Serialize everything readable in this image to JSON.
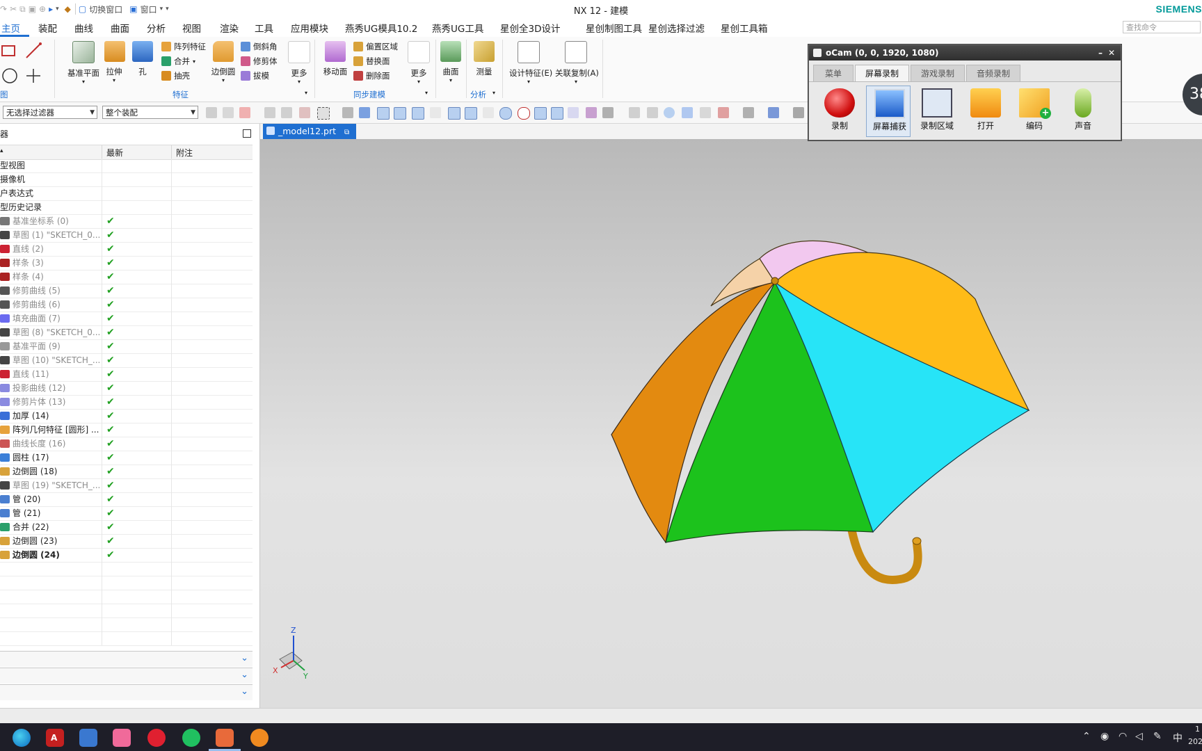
{
  "window": {
    "title": "NX 12 - 建模",
    "brand": "SIEMENS"
  },
  "quick_access": {
    "switch_window": "切换窗口",
    "window": "窗口"
  },
  "menu": {
    "items": [
      "主页",
      "装配",
      "曲线",
      "曲面",
      "分析",
      "视图",
      "渲染",
      "工具",
      "应用模块",
      "燕秀UG模具10.2",
      "燕秀UG工具",
      "星创全3D设计",
      "星创制图工具",
      "星创选择过滤",
      "星创工具箱"
    ],
    "search_placeholder": "查找命令"
  },
  "ribbon": {
    "sketch_group": "图",
    "datum_plane": "基准平面",
    "extrude": "拉伸",
    "hole": "孔",
    "pattern_feature": "阵列特征",
    "unite": "合并",
    "shell": "抽壳",
    "edge_blend": "边倒圆",
    "chamfer": "倒斜角",
    "trim_body": "修剪体",
    "draft": "拔模",
    "more1": "更多",
    "feature_group": "特征",
    "move_face": "移动面",
    "offset_region": "偏置区域",
    "replace_face": "替换面",
    "delete_face": "删除面",
    "more2": "更多",
    "sync_group": "同步建模",
    "surface": "曲面",
    "measure": "测量",
    "analysis_group": "分析",
    "design_feature": "设计特征(E)",
    "associative_copy": "关联复制(A)"
  },
  "filter": {
    "selection_filter": "无选择过滤器",
    "assembly_scope": "整个装配"
  },
  "navigator": {
    "title": "器",
    "col_name": "",
    "col_latest": "最新",
    "col_notes": "附注",
    "top_items": [
      "型视图",
      "摄像机",
      "户表达式",
      "型历史记录"
    ],
    "rows": [
      {
        "name": "基准坐标系 (0)",
        "dim": true,
        "color": "#777"
      },
      {
        "name": "草图 (1) \"SKETCH_0...",
        "dim": true,
        "color": "#444"
      },
      {
        "name": "直线 (2)",
        "dim": true,
        "color": "#c23"
      },
      {
        "name": "样条 (3)",
        "dim": true,
        "color": "#a22"
      },
      {
        "name": "样条 (4)",
        "dim": true,
        "color": "#a22"
      },
      {
        "name": "修剪曲线 (5)",
        "dim": true,
        "color": "#555"
      },
      {
        "name": "修剪曲线 (6)",
        "dim": true,
        "color": "#555"
      },
      {
        "name": "填充曲面 (7)",
        "dim": true,
        "color": "#6a6af0"
      },
      {
        "name": "草图 (8) \"SKETCH_0...",
        "dim": true,
        "color": "#444"
      },
      {
        "name": "基准平面 (9)",
        "dim": true,
        "color": "#999"
      },
      {
        "name": "草图 (10) \"SKETCH_...",
        "dim": true,
        "color": "#444"
      },
      {
        "name": "直线 (11)",
        "dim": true,
        "color": "#c23"
      },
      {
        "name": "投影曲线 (12)",
        "dim": true,
        "color": "#8a8ae0"
      },
      {
        "name": "修剪片体 (13)",
        "dim": true,
        "color": "#8a8ae0"
      },
      {
        "name": "加厚 (14)",
        "dim": false,
        "color": "#3a6fd8"
      },
      {
        "name": "阵列几何特征 [圆形] ...",
        "dim": false,
        "color": "#e6a23c"
      },
      {
        "name": "曲线长度 (16)",
        "dim": true,
        "color": "#c55"
      },
      {
        "name": "圆柱 (17)",
        "dim": false,
        "color": "#3a7fd8"
      },
      {
        "name": "边倒圆 (18)",
        "dim": false,
        "color": "#d8a23a"
      },
      {
        "name": "草图 (19) \"SKETCH_...",
        "dim": true,
        "color": "#444"
      },
      {
        "name": "管 (20)",
        "dim": false,
        "color": "#4a7fd0"
      },
      {
        "name": "管 (21)",
        "dim": false,
        "color": "#4a7fd0"
      },
      {
        "name": "合并 (22)",
        "dim": false,
        "color": "#2aa06a"
      },
      {
        "name": "边倒圆 (23)",
        "dim": false,
        "color": "#d8a23a"
      },
      {
        "name": "边倒圆 (24)",
        "dim": false,
        "bold": true,
        "color": "#d8a23a"
      }
    ],
    "check": "✔"
  },
  "viewport": {
    "file_tab": "_model12.prt",
    "triad": {
      "z": "Z",
      "x": "X",
      "y": "Y"
    }
  },
  "ocam": {
    "title": "oCam (0, 0, 1920, 1080)",
    "tabs": [
      "菜单",
      "屏幕录制",
      "游戏录制",
      "音频录制"
    ],
    "buttons": [
      "录制",
      "屏幕捕获",
      "录制区域",
      "打开",
      "编码",
      "声音"
    ]
  },
  "bubble": "38",
  "taskbar": {
    "ime": "中",
    "clock_top": "1",
    "clock_bottom": "202"
  }
}
